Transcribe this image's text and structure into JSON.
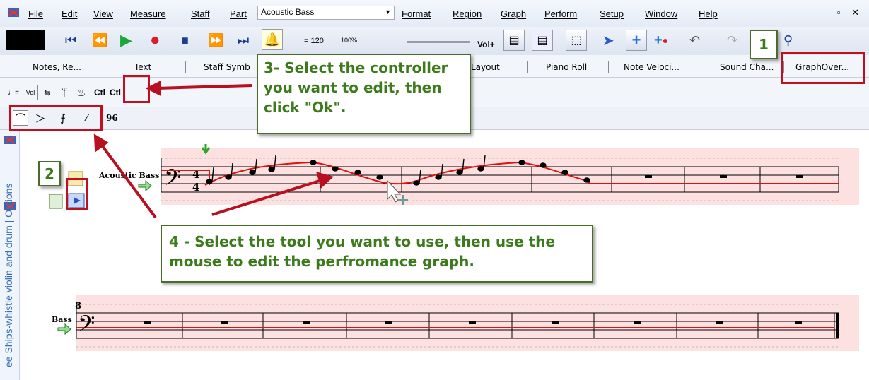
{
  "menu": {
    "items": [
      "File",
      "Edit",
      "View",
      "Measure",
      "Staff",
      "Part",
      "Format",
      "Region",
      "Graph",
      "Perform",
      "Setup",
      "Window",
      "Help"
    ],
    "part_value": "Acoustic Bass"
  },
  "transport": {
    "tempo": "= 120",
    "zoom": "100%",
    "vol_label": "Vol+"
  },
  "tabs": [
    "Notes, Re...",
    "Text",
    "Staff Symb",
    "Layout",
    "Piano Roll",
    "Note Veloci...",
    "Sound Cha...",
    "GraphOver..."
  ],
  "ctrlbar": {
    "ctl1": "Ctl",
    "ctl2": "Ctl"
  },
  "toolrow": {
    "value": "96"
  },
  "sidebar": {
    "vertical_text": "ee Ships-whistle violin and drum | Options"
  },
  "callouts": {
    "one": "1",
    "two": "2",
    "three": "3- Select the controller you want to edit, then click \"Ok\".",
    "four": "4 - Select the tool you want to use, then use the mouse to edit the perfromance graph."
  },
  "staff1": {
    "name": "Acoustic Bass",
    "time_sig_top": "4",
    "time_sig_bottom": "4",
    "clef": "𝄢"
  },
  "staff2": {
    "name": "Bass",
    "measure_number": "8",
    "clef": "𝄢"
  },
  "colors": {
    "highlight": "#c01020",
    "callout_text": "#3d7a1c",
    "staff_bg": "#fde0e0",
    "graph_line": "#e01010"
  }
}
